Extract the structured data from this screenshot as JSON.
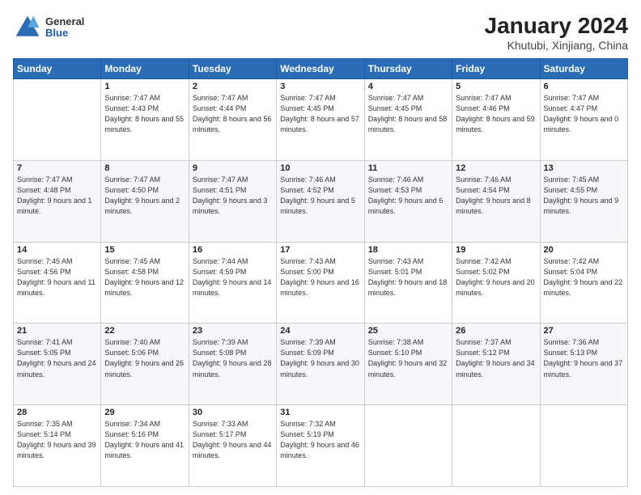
{
  "header": {
    "logo": {
      "general": "General",
      "blue": "Blue"
    },
    "title": "January 2024",
    "subtitle": "Khutubi, Xinjiang, China"
  },
  "weekdays": [
    "Sunday",
    "Monday",
    "Tuesday",
    "Wednesday",
    "Thursday",
    "Friday",
    "Saturday"
  ],
  "weeks": [
    [
      {
        "day": "",
        "empty": true
      },
      {
        "day": "1",
        "sunrise": "Sunrise: 7:47 AM",
        "sunset": "Sunset: 4:43 PM",
        "daylight": "Daylight: 8 hours and 55 minutes."
      },
      {
        "day": "2",
        "sunrise": "Sunrise: 7:47 AM",
        "sunset": "Sunset: 4:44 PM",
        "daylight": "Daylight: 8 hours and 56 minutes."
      },
      {
        "day": "3",
        "sunrise": "Sunrise: 7:47 AM",
        "sunset": "Sunset: 4:45 PM",
        "daylight": "Daylight: 8 hours and 57 minutes."
      },
      {
        "day": "4",
        "sunrise": "Sunrise: 7:47 AM",
        "sunset": "Sunset: 4:45 PM",
        "daylight": "Daylight: 8 hours and 58 minutes."
      },
      {
        "day": "5",
        "sunrise": "Sunrise: 7:47 AM",
        "sunset": "Sunset: 4:46 PM",
        "daylight": "Daylight: 8 hours and 59 minutes."
      },
      {
        "day": "6",
        "sunrise": "Sunrise: 7:47 AM",
        "sunset": "Sunset: 4:47 PM",
        "daylight": "Daylight: 9 hours and 0 minutes."
      }
    ],
    [
      {
        "day": "7",
        "sunrise": "Sunrise: 7:47 AM",
        "sunset": "Sunset: 4:48 PM",
        "daylight": "Daylight: 9 hours and 1 minute."
      },
      {
        "day": "8",
        "sunrise": "Sunrise: 7:47 AM",
        "sunset": "Sunset: 4:50 PM",
        "daylight": "Daylight: 9 hours and 2 minutes."
      },
      {
        "day": "9",
        "sunrise": "Sunrise: 7:47 AM",
        "sunset": "Sunset: 4:51 PM",
        "daylight": "Daylight: 9 hours and 3 minutes."
      },
      {
        "day": "10",
        "sunrise": "Sunrise: 7:46 AM",
        "sunset": "Sunset: 4:52 PM",
        "daylight": "Daylight: 9 hours and 5 minutes."
      },
      {
        "day": "11",
        "sunrise": "Sunrise: 7:46 AM",
        "sunset": "Sunset: 4:53 PM",
        "daylight": "Daylight: 9 hours and 6 minutes."
      },
      {
        "day": "12",
        "sunrise": "Sunrise: 7:46 AM",
        "sunset": "Sunset: 4:54 PM",
        "daylight": "Daylight: 9 hours and 8 minutes."
      },
      {
        "day": "13",
        "sunrise": "Sunrise: 7:45 AM",
        "sunset": "Sunset: 4:55 PM",
        "daylight": "Daylight: 9 hours and 9 minutes."
      }
    ],
    [
      {
        "day": "14",
        "sunrise": "Sunrise: 7:45 AM",
        "sunset": "Sunset: 4:56 PM",
        "daylight": "Daylight: 9 hours and 11 minutes."
      },
      {
        "day": "15",
        "sunrise": "Sunrise: 7:45 AM",
        "sunset": "Sunset: 4:58 PM",
        "daylight": "Daylight: 9 hours and 12 minutes."
      },
      {
        "day": "16",
        "sunrise": "Sunrise: 7:44 AM",
        "sunset": "Sunset: 4:59 PM",
        "daylight": "Daylight: 9 hours and 14 minutes."
      },
      {
        "day": "17",
        "sunrise": "Sunrise: 7:43 AM",
        "sunset": "Sunset: 5:00 PM",
        "daylight": "Daylight: 9 hours and 16 minutes."
      },
      {
        "day": "18",
        "sunrise": "Sunrise: 7:43 AM",
        "sunset": "Sunset: 5:01 PM",
        "daylight": "Daylight: 9 hours and 18 minutes."
      },
      {
        "day": "19",
        "sunrise": "Sunrise: 7:42 AM",
        "sunset": "Sunset: 5:02 PM",
        "daylight": "Daylight: 9 hours and 20 minutes."
      },
      {
        "day": "20",
        "sunrise": "Sunrise: 7:42 AM",
        "sunset": "Sunset: 5:04 PM",
        "daylight": "Daylight: 9 hours and 22 minutes."
      }
    ],
    [
      {
        "day": "21",
        "sunrise": "Sunrise: 7:41 AM",
        "sunset": "Sunset: 5:05 PM",
        "daylight": "Daylight: 9 hours and 24 minutes."
      },
      {
        "day": "22",
        "sunrise": "Sunrise: 7:40 AM",
        "sunset": "Sunset: 5:06 PM",
        "daylight": "Daylight: 9 hours and 26 minutes."
      },
      {
        "day": "23",
        "sunrise": "Sunrise: 7:39 AM",
        "sunset": "Sunset: 5:08 PM",
        "daylight": "Daylight: 9 hours and 28 minutes."
      },
      {
        "day": "24",
        "sunrise": "Sunrise: 7:39 AM",
        "sunset": "Sunset: 5:09 PM",
        "daylight": "Daylight: 9 hours and 30 minutes."
      },
      {
        "day": "25",
        "sunrise": "Sunrise: 7:38 AM",
        "sunset": "Sunset: 5:10 PM",
        "daylight": "Daylight: 9 hours and 32 minutes."
      },
      {
        "day": "26",
        "sunrise": "Sunrise: 7:37 AM",
        "sunset": "Sunset: 5:12 PM",
        "daylight": "Daylight: 9 hours and 34 minutes."
      },
      {
        "day": "27",
        "sunrise": "Sunrise: 7:36 AM",
        "sunset": "Sunset: 5:13 PM",
        "daylight": "Daylight: 9 hours and 37 minutes."
      }
    ],
    [
      {
        "day": "28",
        "sunrise": "Sunrise: 7:35 AM",
        "sunset": "Sunset: 5:14 PM",
        "daylight": "Daylight: 9 hours and 39 minutes."
      },
      {
        "day": "29",
        "sunrise": "Sunrise: 7:34 AM",
        "sunset": "Sunset: 5:16 PM",
        "daylight": "Daylight: 9 hours and 41 minutes."
      },
      {
        "day": "30",
        "sunrise": "Sunrise: 7:33 AM",
        "sunset": "Sunset: 5:17 PM",
        "daylight": "Daylight: 9 hours and 44 minutes."
      },
      {
        "day": "31",
        "sunrise": "Sunrise: 7:32 AM",
        "sunset": "Sunset: 5:19 PM",
        "daylight": "Daylight: 9 hours and 46 minutes."
      },
      {
        "day": "",
        "empty": true
      },
      {
        "day": "",
        "empty": true
      },
      {
        "day": "",
        "empty": true
      }
    ]
  ]
}
